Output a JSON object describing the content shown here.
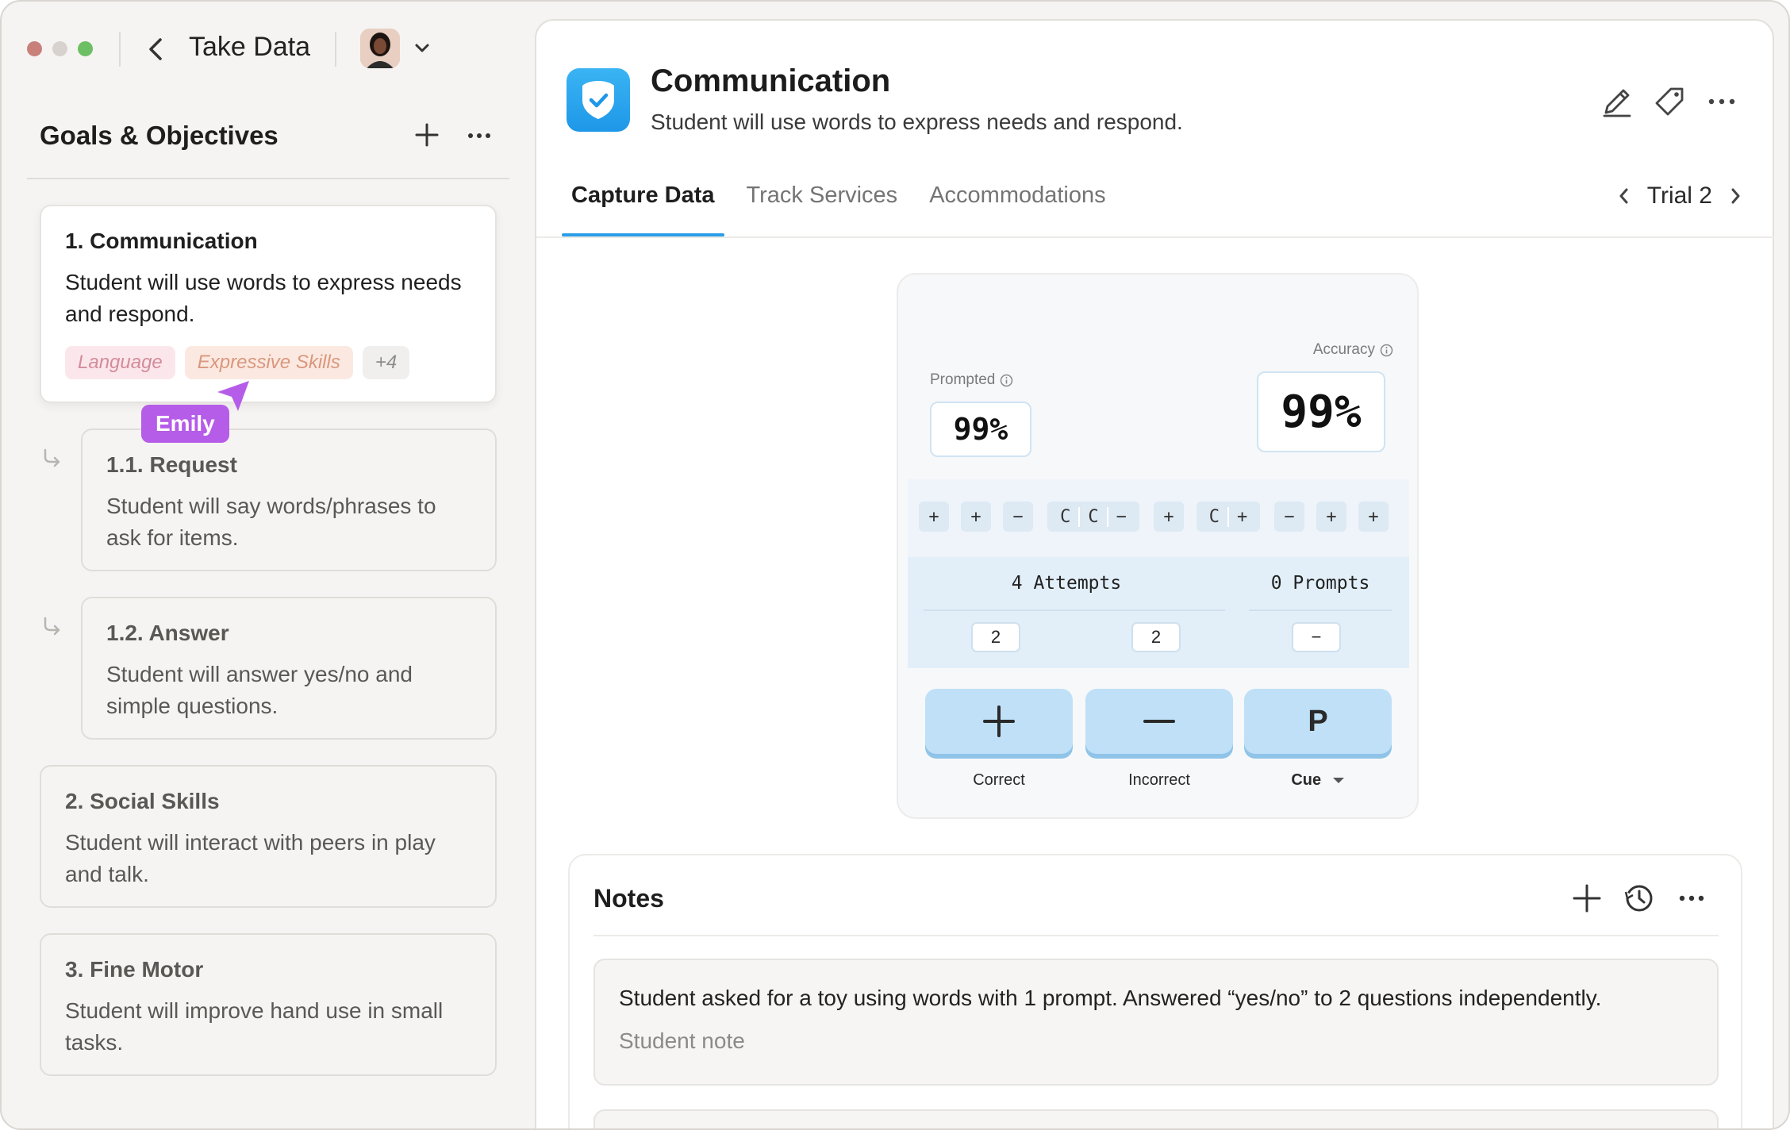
{
  "titlebar": {
    "title": "Take Data"
  },
  "sidebar": {
    "heading": "Goals & Objectives",
    "goals": [
      {
        "title": "1. Communication",
        "description": "Student will use words to express needs and respond.",
        "chips": [
          "Language",
          "Expressive Skills",
          "+4"
        ]
      },
      {
        "title": "1.1. Request",
        "description": "Student will say words/phrases to ask for items."
      },
      {
        "title": "1.2. Answer",
        "description": "Student will answer yes/no and simple questions."
      },
      {
        "title": "2. Social Skills",
        "description": "Student will interact with peers in play and talk."
      },
      {
        "title": "3. Fine Motor",
        "description": "Student will improve hand use in small tasks."
      }
    ],
    "cursor_label": "Emily"
  },
  "header": {
    "title": "Communication",
    "subtitle": "Student will use words to express needs and respond."
  },
  "tabs": [
    "Capture Data",
    "Track Services",
    "Accommodations"
  ],
  "trial": {
    "label": "Trial 2"
  },
  "capture": {
    "prompted_label": "Prompted",
    "prompted_value": "99%",
    "accuracy_label": "Accuracy",
    "accuracy_value": "99%",
    "trial_tokens": [
      "+",
      "+",
      "−",
      "C",
      "C",
      "−",
      "+",
      "C",
      "+",
      "−",
      "+",
      "+"
    ],
    "attempts_label": "4 Attempts",
    "prompts_label": "0 Prompts",
    "correct_count": "2",
    "incorrect_count": "2",
    "prompt_count": "−",
    "buttons": {
      "correct": "Correct",
      "incorrect": "Incorrect",
      "cue": "Cue",
      "cue_letter": "P"
    }
  },
  "notes": {
    "title": "Notes",
    "items": [
      {
        "text": "Student asked for a toy using words with 1 prompt. Answered “yes/no” to 2 questions independently.",
        "tag": "Student note"
      }
    ]
  },
  "colors": {
    "accent": "#2b9ee8",
    "cursor": "#b55de8",
    "button": "#bfe0f7"
  }
}
